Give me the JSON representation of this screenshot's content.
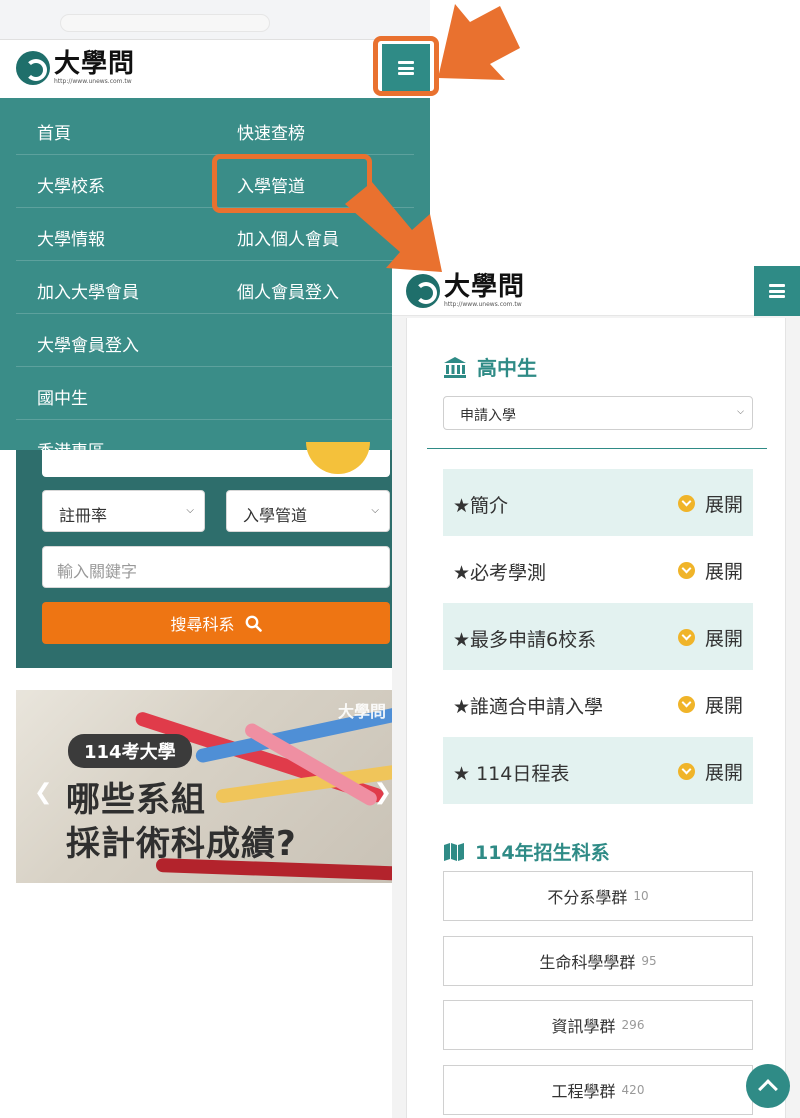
{
  "left": {
    "logo": {
      "name": "大學問",
      "url": "http://www.unews.com.tw"
    },
    "menu": {
      "items": [
        {
          "label": "首頁"
        },
        {
          "label": "快速查榜"
        },
        {
          "label": "大學校系"
        },
        {
          "label": "入學管道"
        },
        {
          "label": "大學情報"
        },
        {
          "label": "加入個人會員"
        },
        {
          "label": "加入大學會員"
        },
        {
          "label": "個人會員登入"
        },
        {
          "label": "大學會員登入"
        },
        {
          "label": "國中生"
        },
        {
          "label": "香港專區"
        }
      ]
    },
    "search": {
      "select_rate": "註冊率",
      "select_channel": "入學管道",
      "keyword_placeholder": "輸入關鍵字",
      "button_label": "搜尋科系"
    },
    "banner": {
      "tag": "114考大學",
      "headline_line1": "哪些系組",
      "headline_line2": "採計術科成績?",
      "watermark": "大學問"
    }
  },
  "right": {
    "logo": {
      "name": "大學問",
      "url": "http://www.unews.com.tw"
    },
    "section_title": "高中生",
    "dropdown_value": "申請入學",
    "expand_label": "展開",
    "accordion": [
      {
        "title": "★簡介"
      },
      {
        "title": "★必考學測"
      },
      {
        "title": "★最多申請6校系"
      },
      {
        "title": "★誰適合申請入學"
      },
      {
        "title": "★ 114日程表"
      }
    ],
    "groups_title": "114年招生科系",
    "groups": [
      {
        "name": "不分系學群",
        "count": "10"
      },
      {
        "name": "生命科學學群",
        "count": "95"
      },
      {
        "name": "資訊學群",
        "count": "296"
      },
      {
        "name": "工程學群",
        "count": "420"
      }
    ]
  },
  "colors": {
    "teal": "#3a8d88",
    "teal_dark": "#2e6e6c",
    "orange": "#ee7513",
    "annotation": "#e9712f",
    "badge": "#f0b429",
    "accordion_bg": "#e3f2f0"
  },
  "icons": [
    "hamburger-icon",
    "search-icon",
    "chevron-down-icon",
    "bank-icon",
    "map-icon",
    "chevron-up-icon",
    "arrow-left-icon",
    "arrow-right-icon"
  ]
}
